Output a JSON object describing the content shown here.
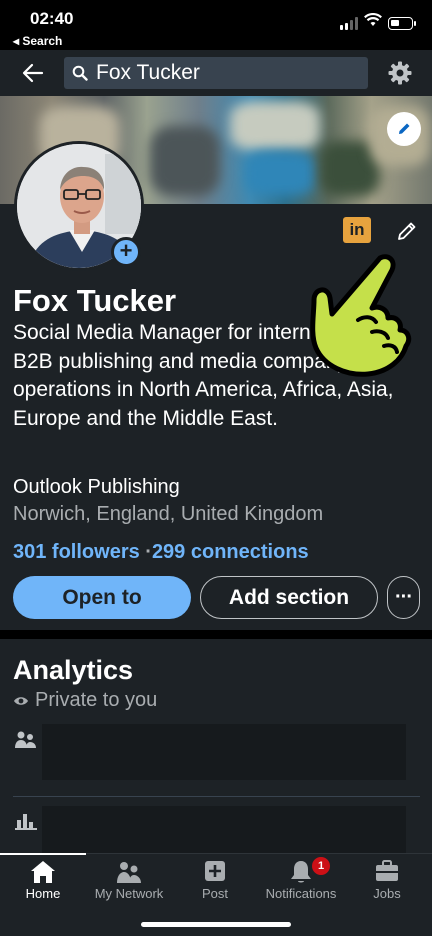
{
  "status": {
    "time": "02:40",
    "back_label": "◂ Search"
  },
  "search": {
    "query": "Fox Tucker"
  },
  "profile": {
    "name": "Fox Tucker",
    "headline": "Social Media Manager for international B2B publishing and media company with operations in North America, Africa, Asia, Europe and the Middle East.",
    "company": "Outlook Publishing",
    "location": "Norwich, England, United Kingdom",
    "followers": "301 followers",
    "separator": " ·",
    "connections": "299 connections",
    "badge_text": "in"
  },
  "actions": {
    "open_to": "Open to",
    "add_section": "Add section",
    "more": "···"
  },
  "analytics": {
    "title": "Analytics",
    "privacy": "Private to you"
  },
  "nav": {
    "items": [
      {
        "label": "Home",
        "icon": "home-icon"
      },
      {
        "label": "My Network",
        "icon": "network-icon"
      },
      {
        "label": "Post",
        "icon": "post-icon"
      },
      {
        "label": "Notifications",
        "icon": "bell-icon",
        "badge": "1"
      },
      {
        "label": "Jobs",
        "icon": "briefcase-icon"
      }
    ]
  },
  "colors": {
    "accent": "#70b5f9",
    "background": "#1d2226",
    "badge": "#e7a33e",
    "pointer": "#c5e04a"
  }
}
